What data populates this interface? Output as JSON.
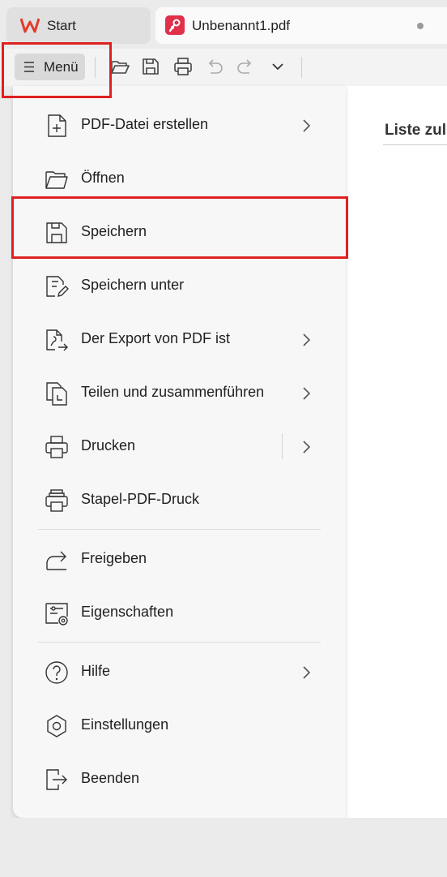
{
  "tabs": {
    "start_label": "Start",
    "doc_label": "Unbenannt1.pdf"
  },
  "toolbar": {
    "menu_label": "Menü"
  },
  "document": {
    "title": "Liste zul"
  },
  "menu": {
    "items": [
      {
        "label": "PDF-Datei erstellen",
        "icon": "create-pdf-icon",
        "submenu": true
      },
      {
        "label": "Öffnen",
        "icon": "folder-open-icon",
        "submenu": false
      },
      {
        "label": "Speichern",
        "icon": "save-icon",
        "submenu": false
      },
      {
        "label": "Speichern unter",
        "icon": "save-as-icon",
        "submenu": false
      },
      {
        "label": "Der Export von PDF ist",
        "icon": "export-pdf-icon",
        "submenu": true
      },
      {
        "label": "Teilen und zusammenführen",
        "icon": "split-merge-icon",
        "submenu": true
      },
      {
        "label": "Drucken",
        "icon": "printer-icon",
        "submenu": true
      },
      {
        "label": "Stapel-PDF-Druck",
        "icon": "batch-print-icon",
        "submenu": false
      },
      {
        "label": "Freigeben",
        "icon": "share-icon",
        "submenu": false
      },
      {
        "label": "Eigenschaften",
        "icon": "properties-icon",
        "submenu": false
      },
      {
        "label": "Hilfe",
        "icon": "help-icon",
        "submenu": true
      },
      {
        "label": "Einstellungen",
        "icon": "settings-icon",
        "submenu": false
      },
      {
        "label": "Beenden",
        "icon": "exit-icon",
        "submenu": false
      }
    ]
  },
  "colors": {
    "highlight": "#e02020",
    "pdf_brand": "#e0304a",
    "wps_brand": "#e23c2a"
  }
}
